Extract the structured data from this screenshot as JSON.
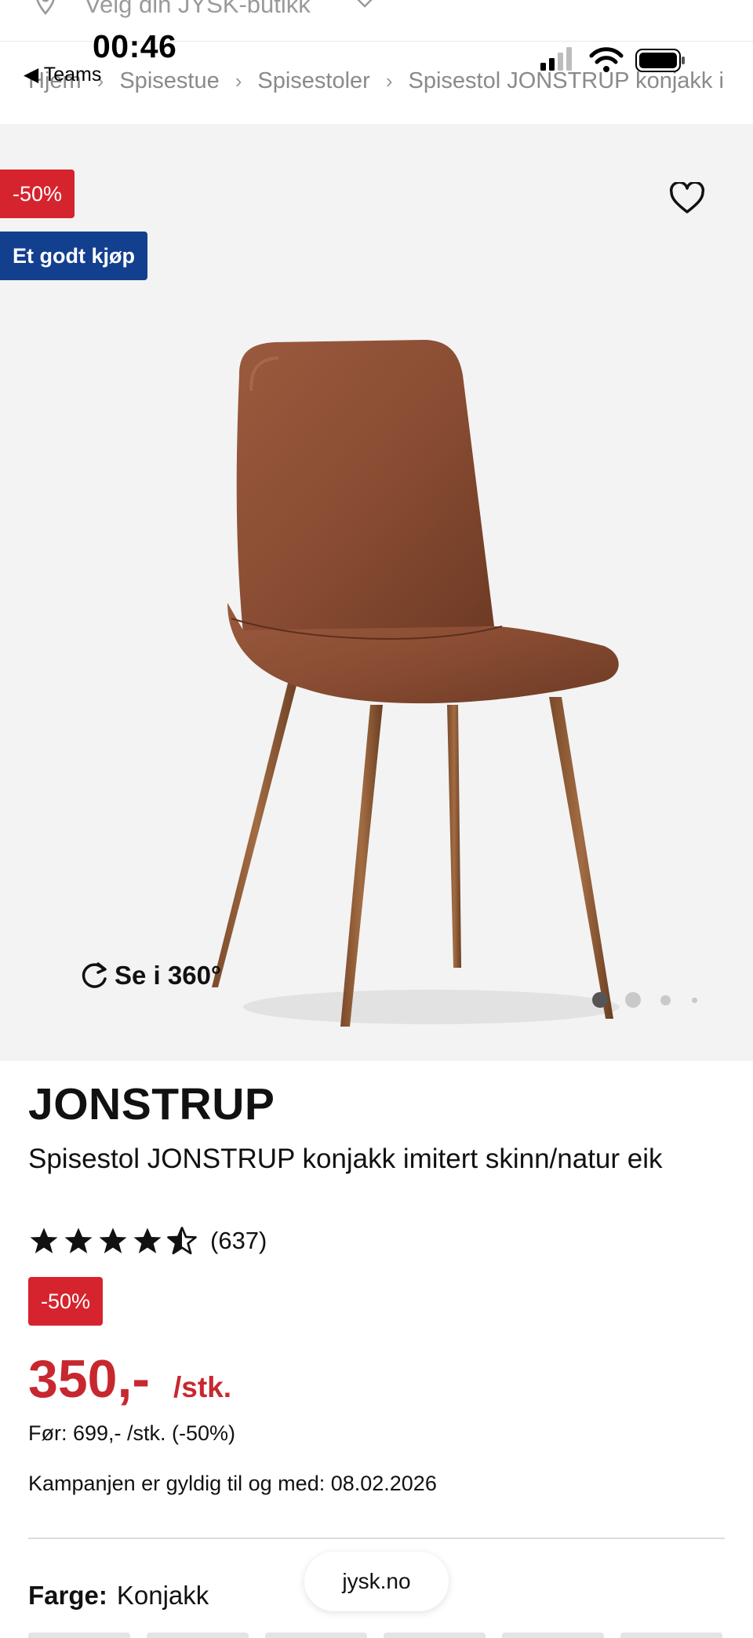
{
  "store": {
    "label": "Velg din JYSK-butikk"
  },
  "status": {
    "time": "00:46",
    "back_label": "◀ Teams"
  },
  "breadcrumb": [
    "Hjem",
    "Spisestue",
    "Spisestoler",
    "Spisestol JONSTRUP konjakk i"
  ],
  "hero": {
    "discount_badge": "-50%",
    "good_buy_badge": "Et godt kjøp",
    "view_360": "Se i 360°",
    "active_image": 1,
    "image_count": 4
  },
  "product": {
    "brand": "JONSTRUP",
    "subtitle": "Spisestol JONSTRUP konjakk imitert skinn/natur eik",
    "rating": 4.5,
    "rating_count": "(637)",
    "discount": "-50%",
    "price": "350,-",
    "unit": "/stk.",
    "before": "Før: 699,- /stk. (-50%)",
    "campaign": "Kampanjen er gyldig til og med: 08.02.2026",
    "color_label": "Farge:",
    "color_value": "Konjakk"
  },
  "browser": {
    "url": "jysk.no"
  },
  "colors": {
    "sale": "#c7282f",
    "badge_blue": "#133f8f",
    "badge_red": "#d6242e"
  }
}
